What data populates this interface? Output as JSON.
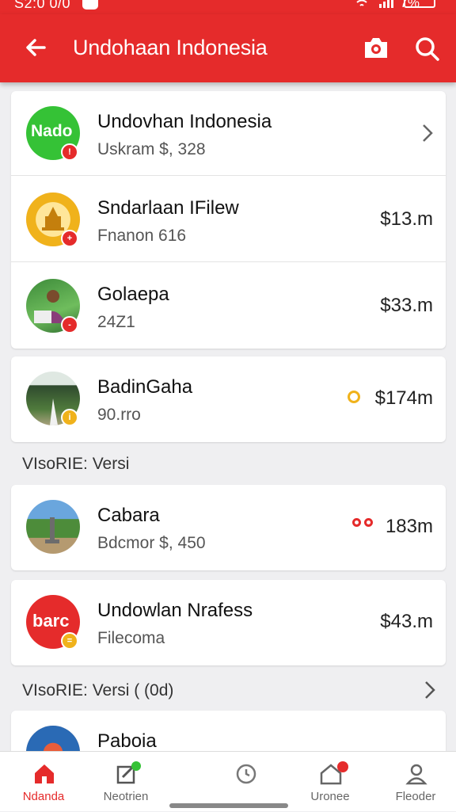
{
  "status_bar": {
    "time": "S2:0 0/0",
    "battery": "7%"
  },
  "app_bar": {
    "title": "Undohaan Indonesia",
    "icons": [
      "back-arrow-icon",
      "camera-icon",
      "search-icon"
    ]
  },
  "colors": {
    "accent": "#e52b2b",
    "green": "#35c236",
    "gold": "#f0b21b"
  },
  "group1": [
    {
      "title": "Undovhan Indonesia",
      "subtitle": "Uskram $, 328",
      "amount": "",
      "avatar_text": "Nado",
      "avatar": "green-logo"
    },
    {
      "title": "Sndarlaan IFilew",
      "subtitle": "Fnanon 616",
      "amount": "$13.m",
      "avatar": "gold-temple-emblem"
    },
    {
      "title": "Golaepa",
      "subtitle": "24Z1",
      "amount": "$33.m",
      "avatar": "person-photo"
    }
  ],
  "group2": [
    {
      "title": "BadinGaha",
      "subtitle": "90.rro",
      "amount": "$174m",
      "avatar": "forest-photo"
    }
  ],
  "section1": {
    "label": "VIsoRIE: Versi"
  },
  "group3": [
    {
      "title": "Cabara",
      "subtitle": "Bdcmor $, 450",
      "amount": "183m",
      "avatar": "landscape-photo"
    }
  ],
  "group4": [
    {
      "title": "Undowlan Nrafess",
      "subtitle": "Filecoma",
      "amount": "$43.m",
      "avatar_text": "barc",
      "avatar": "red-logo"
    }
  ],
  "section2": {
    "label": "VIsoRIE: Versi ( (0d)"
  },
  "group5": [
    {
      "title": "Paboia",
      "avatar": "globe-photo"
    }
  ],
  "bottom_nav": [
    {
      "label": "Ndanda",
      "icon": "home-icon",
      "active": true
    },
    {
      "label": "Neotrien",
      "icon": "edit-icon",
      "active": false
    },
    {
      "label": "",
      "icon": "clock-icon",
      "active": false
    },
    {
      "label": "Uronee",
      "icon": "house-icon",
      "active": false
    },
    {
      "label": "Fleoder",
      "icon": "profile-icon",
      "active": false
    }
  ]
}
